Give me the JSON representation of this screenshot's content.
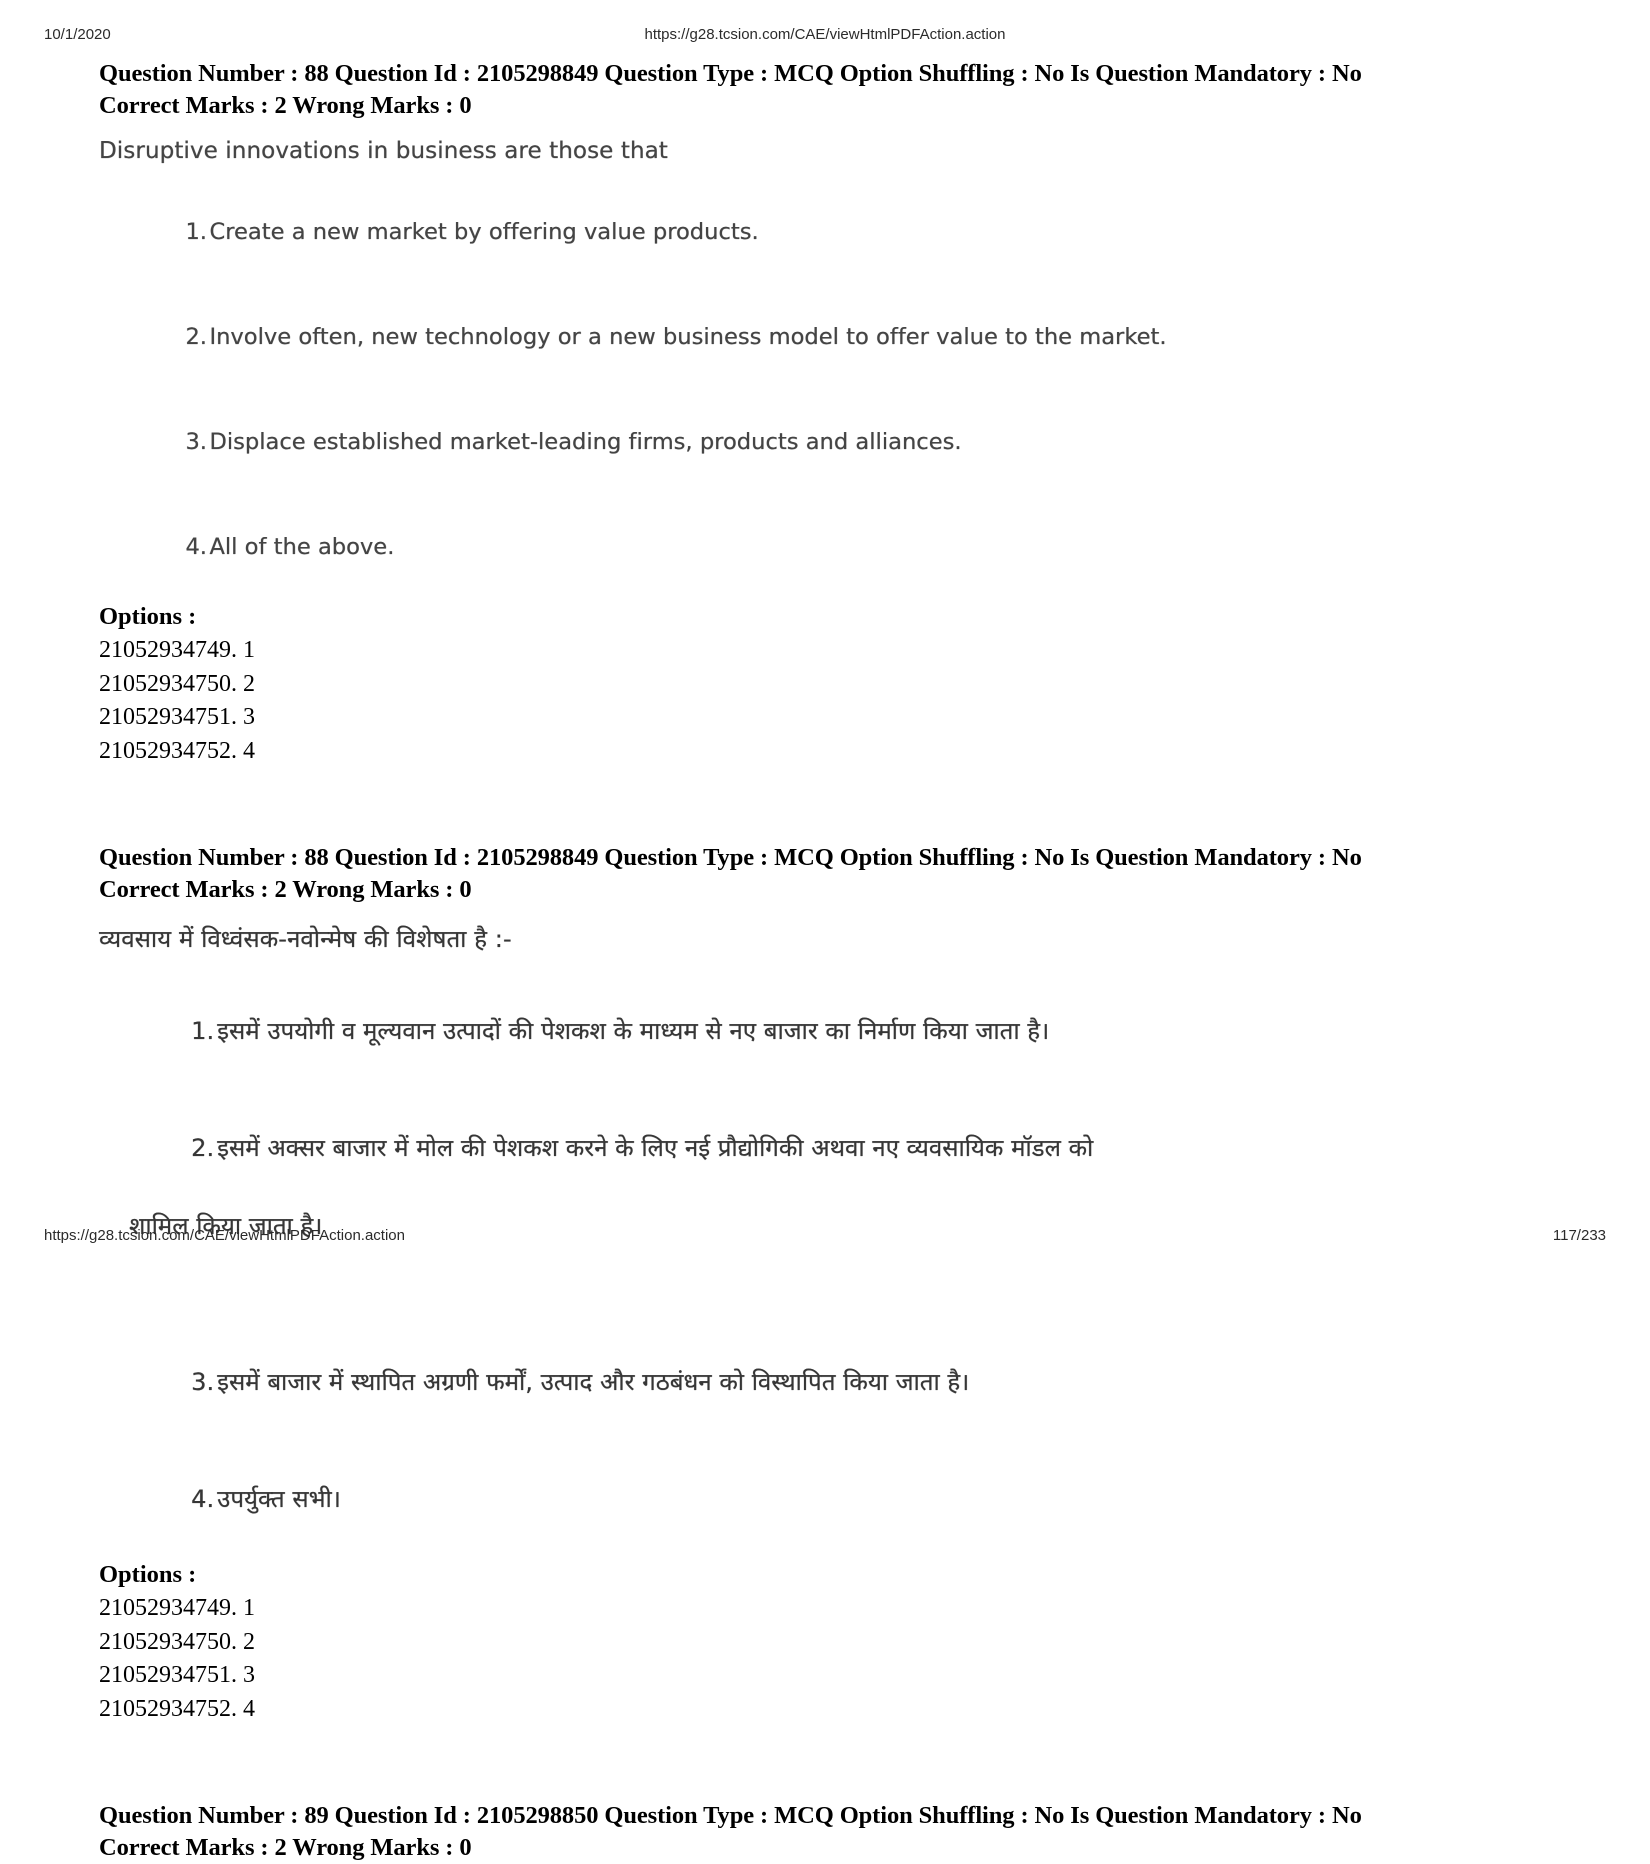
{
  "header": {
    "date": "10/1/2020",
    "url": "https://g28.tcsion.com/CAE/viewHtmlPDFAction.action"
  },
  "footer": {
    "url": "https://g28.tcsion.com/CAE/viewHtmlPDFAction.action",
    "page_number": "117/233"
  },
  "questions": [
    {
      "meta_line1": "Question Number : 88 Question Id : 2105298849 Question Type : MCQ Option Shuffling : No Is Question Mandatory : No",
      "meta_line2": "Correct Marks : 2 Wrong Marks : 0",
      "stem": "Disruptive innovations in business are those that",
      "choices": [
        {
          "num": "1.",
          "text": "Create a new market by offering value products."
        },
        {
          "num": "2.",
          "text": "Involve often, new technology or a new business model to offer value to the market."
        },
        {
          "num": "3.",
          "text": "Displace established market-leading firms, products and alliances."
        },
        {
          "num": "4.",
          "text": "All of the above."
        }
      ],
      "options_label": "Options :",
      "options": [
        "21052934749. 1",
        "21052934750. 2",
        "21052934751. 3",
        "21052934752. 4"
      ]
    },
    {
      "meta_line1": "Question Number : 88 Question Id : 2105298849 Question Type : MCQ Option Shuffling : No Is Question Mandatory : No",
      "meta_line2": "Correct Marks : 2 Wrong Marks : 0",
      "stem": "व्यवसाय में विध्वंसक-नवोन्मेष की विशेषता है :-",
      "choices": [
        {
          "num": "1.",
          "text": "इसमें उपयोगी व मूल्यवान उत्पादों की पेशकश के माध्यम से नए बाजार का निर्माण किया जाता है।",
          "cont": ""
        },
        {
          "num": "2.",
          "text": "इसमें अक्सर बाजार में मोल की पेशकश करने के लिए नई प्रौद्योगिकी अथवा नए व्यवसायिक मॉडल को",
          "cont": "शामिल किया जाता है।"
        },
        {
          "num": "3.",
          "text": "इसमें बाजार में स्थापित अग्रणी फर्मों, उत्पाद और गठबंधन को विस्थापित किया जाता है।",
          "cont": ""
        },
        {
          "num": "4.",
          "text": "उपर्युक्त सभी।",
          "cont": ""
        }
      ],
      "options_label": "Options :",
      "options": [
        "21052934749. 1",
        "21052934750. 2",
        "21052934751. 3",
        "21052934752. 4"
      ]
    },
    {
      "meta_line1": "Question Number : 89 Question Id : 2105298850 Question Type : MCQ Option Shuffling : No Is Question Mandatory : No",
      "meta_line2": "Correct Marks : 2 Wrong Marks : 0"
    }
  ]
}
